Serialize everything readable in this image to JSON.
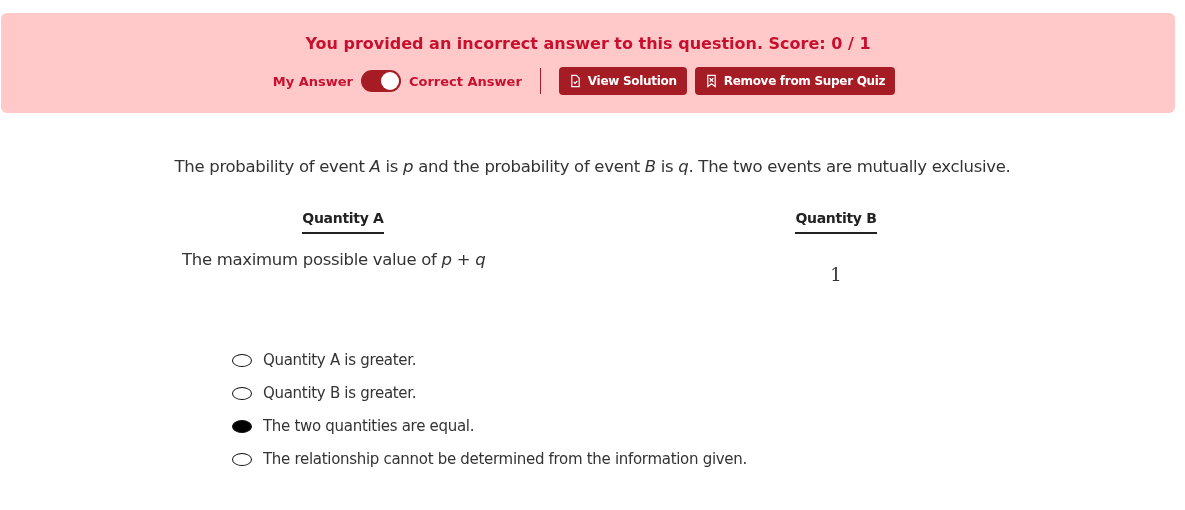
{
  "feedback": {
    "message": "You provided an incorrect answer to this question. Score: 0 / 1",
    "toggle": {
      "left_label": "My Answer",
      "right_label": "Correct Answer",
      "on": true
    },
    "buttons": [
      {
        "label": "View Solution",
        "kind": "solution"
      },
      {
        "label": "Remove from Super Quiz",
        "kind": "remove"
      }
    ]
  },
  "question": "The probability of event *A* is *p* and the probability of event *B* is *q*. The two events are mutually exclusive.",
  "quantities": [
    {
      "heading": "Quantity A",
      "text": "The maximum possible value of *p* + *q*",
      "kind": "text"
    },
    {
      "heading": "Quantity B",
      "text": "1",
      "kind": "math"
    }
  ],
  "choices": [
    {
      "label": "Quantity A is greater.",
      "selected": false
    },
    {
      "label": "Quantity B is greater.",
      "selected": false
    },
    {
      "label": "The two quantities are equal.",
      "selected": true
    },
    {
      "label": "The relationship cannot be determined from the information given.",
      "selected": false
    }
  ]
}
